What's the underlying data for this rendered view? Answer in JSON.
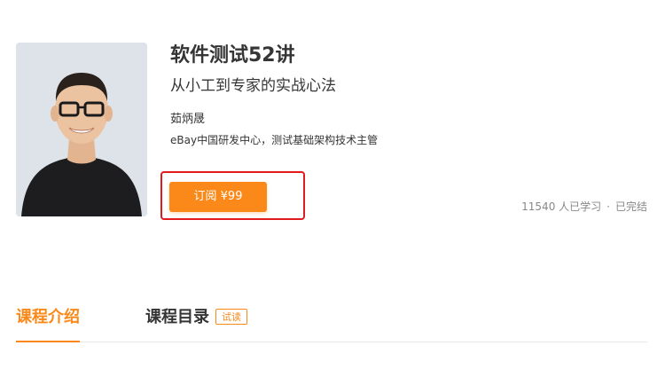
{
  "course": {
    "title": "软件测试52讲",
    "subtitle": "从小工到专家的实战心法",
    "author_name": "茹炳晟",
    "author_intro": "eBay中国研发中心，测试基础架构技术主管",
    "subscribe_label": "订阅 ¥99",
    "learners_text": "11540 人已学习",
    "separator": "·",
    "status_text": "已完结"
  },
  "tabs": {
    "intro_label": "课程介绍",
    "catalog_label": "课程目录",
    "trial_badge": "试读"
  },
  "colors": {
    "accent": "#fa8919",
    "highlight_frame": "#e11b1b",
    "text": "#353535",
    "muted": "#888888"
  },
  "icons": {
    "cover": "author-photo"
  }
}
